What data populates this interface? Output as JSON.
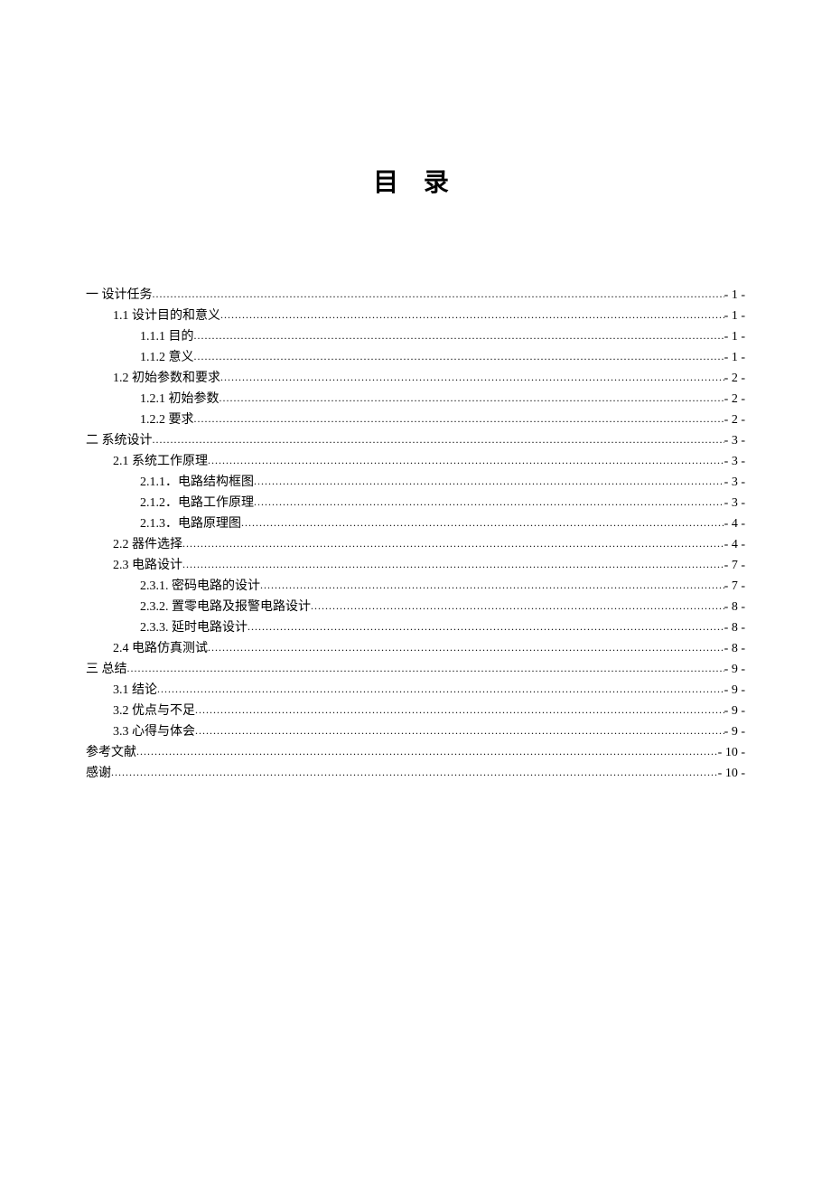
{
  "title": "目 录",
  "toc": [
    {
      "indent": 0,
      "text": "一  设计任务",
      "page": "- 1 -"
    },
    {
      "indent": 1,
      "text": "1.1 设计目的和意义",
      "page": "- 1 -"
    },
    {
      "indent": 2,
      "text": "1.1.1 目的",
      "page": "- 1 -"
    },
    {
      "indent": 2,
      "text": "1.1.2 意义",
      "page": "- 1 -"
    },
    {
      "indent": 1,
      "text": "1.2 初始参数和要求",
      "page": "- 2 -"
    },
    {
      "indent": 2,
      "text": "1.2.1  初始参数",
      "page": "- 2 -"
    },
    {
      "indent": 2,
      "text": "1.2.2  要求",
      "page": "- 2 -"
    },
    {
      "indent": 0,
      "text": "二  系统设计",
      "page": "- 3 -"
    },
    {
      "indent": 1,
      "text": "2.1 系统工作原理",
      "page": "- 3 -"
    },
    {
      "indent": 2,
      "text": "2.1.1．电路结构框图",
      "page": "- 3 -"
    },
    {
      "indent": 2,
      "text": "2.1.2．电路工作原理",
      "page": "- 3 -"
    },
    {
      "indent": 2,
      "text": "2.1.3．电路原理图",
      "page": "- 4 -"
    },
    {
      "indent": 1,
      "text": "2.2  器件选择",
      "page": "- 4 -"
    },
    {
      "indent": 1,
      "text": "2.3 电路设计",
      "page": "- 7 -"
    },
    {
      "indent": 2,
      "text": "2.3.1.  密码电路的设计",
      "page": "- 7 -"
    },
    {
      "indent": 2,
      "text": "2.3.2.  置零电路及报警电路设计",
      "page": "- 8 -"
    },
    {
      "indent": 2,
      "text": "2.3.3.  延时电路设计",
      "page": "- 8 -"
    },
    {
      "indent": 1,
      "text": "2.4  电路仿真测试",
      "page": "- 8 -"
    },
    {
      "indent": 0,
      "text": "三  总结",
      "page": "- 9 -"
    },
    {
      "indent": 1,
      "text": "3.1 结论",
      "page": "- 9 -"
    },
    {
      "indent": 1,
      "text": "3.2 优点与不足",
      "page": "- 9 -"
    },
    {
      "indent": 1,
      "text": "3.3  心得与体会",
      "page": "- 9 -"
    },
    {
      "indent": 0,
      "text": "参考文献",
      "page": "- 10 -"
    },
    {
      "indent": 0,
      "text": "感谢",
      "page": "- 10 -"
    }
  ]
}
